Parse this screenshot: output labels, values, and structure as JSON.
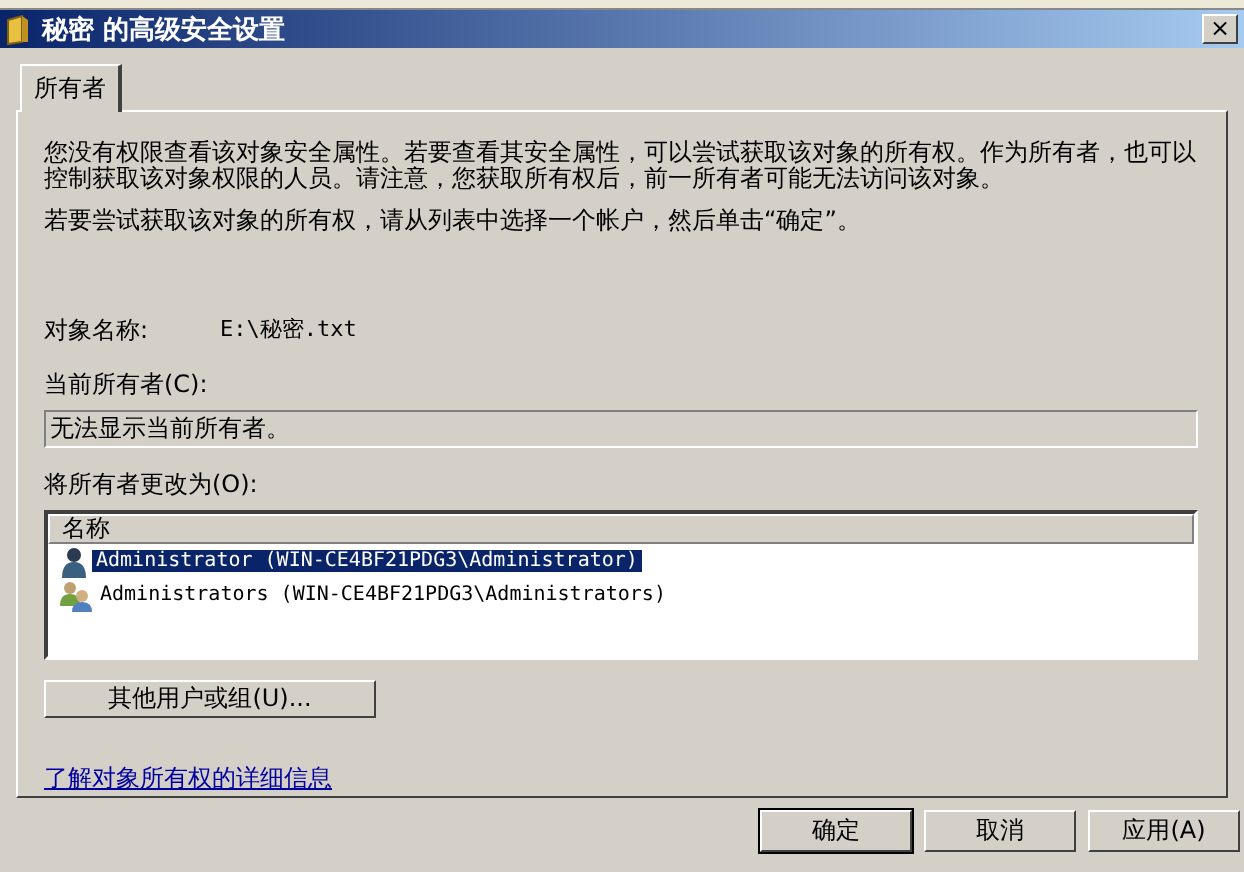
{
  "window": {
    "title": "秘密 的高级安全设置",
    "close": "×"
  },
  "tabs": [
    {
      "label": "所有者",
      "selected": true
    }
  ],
  "intro": [
    "您没有权限查看该对象安全属性。若要查看其安全属性，可以尝试获取该对象的所有权。作为所有者，也可以控制获取该对象权限的人员。请注意，您获取所有权后，前一所有者可能无法访问该对象。",
    "若要尝试获取该对象的所有权，请从列表中选择一个帐户，然后单击“确定”。"
  ],
  "object_name": {
    "label": "对象名称:",
    "value": "E:\\秘密.txt"
  },
  "current_owner": {
    "label": "当前所有者(C):",
    "value": "无法显示当前所有者。"
  },
  "change_owner": {
    "label": "将所有者更改为(O):",
    "column": "名称",
    "items": [
      {
        "name": "Administrator (WIN-CE4BF21PDG3\\Administrator)",
        "kind": "user",
        "selected": true
      },
      {
        "name": "Administrators (WIN-CE4BF21PDG3\\Administrators)",
        "kind": "group",
        "selected": false
      }
    ]
  },
  "other_button": "其他用户或组(U)...",
  "link": "了解对象所有权的详细信息",
  "buttons": [
    {
      "label": "确定",
      "default": true
    },
    {
      "label": "取消",
      "default": false
    },
    {
      "label": "应用(A)",
      "default": false
    }
  ]
}
